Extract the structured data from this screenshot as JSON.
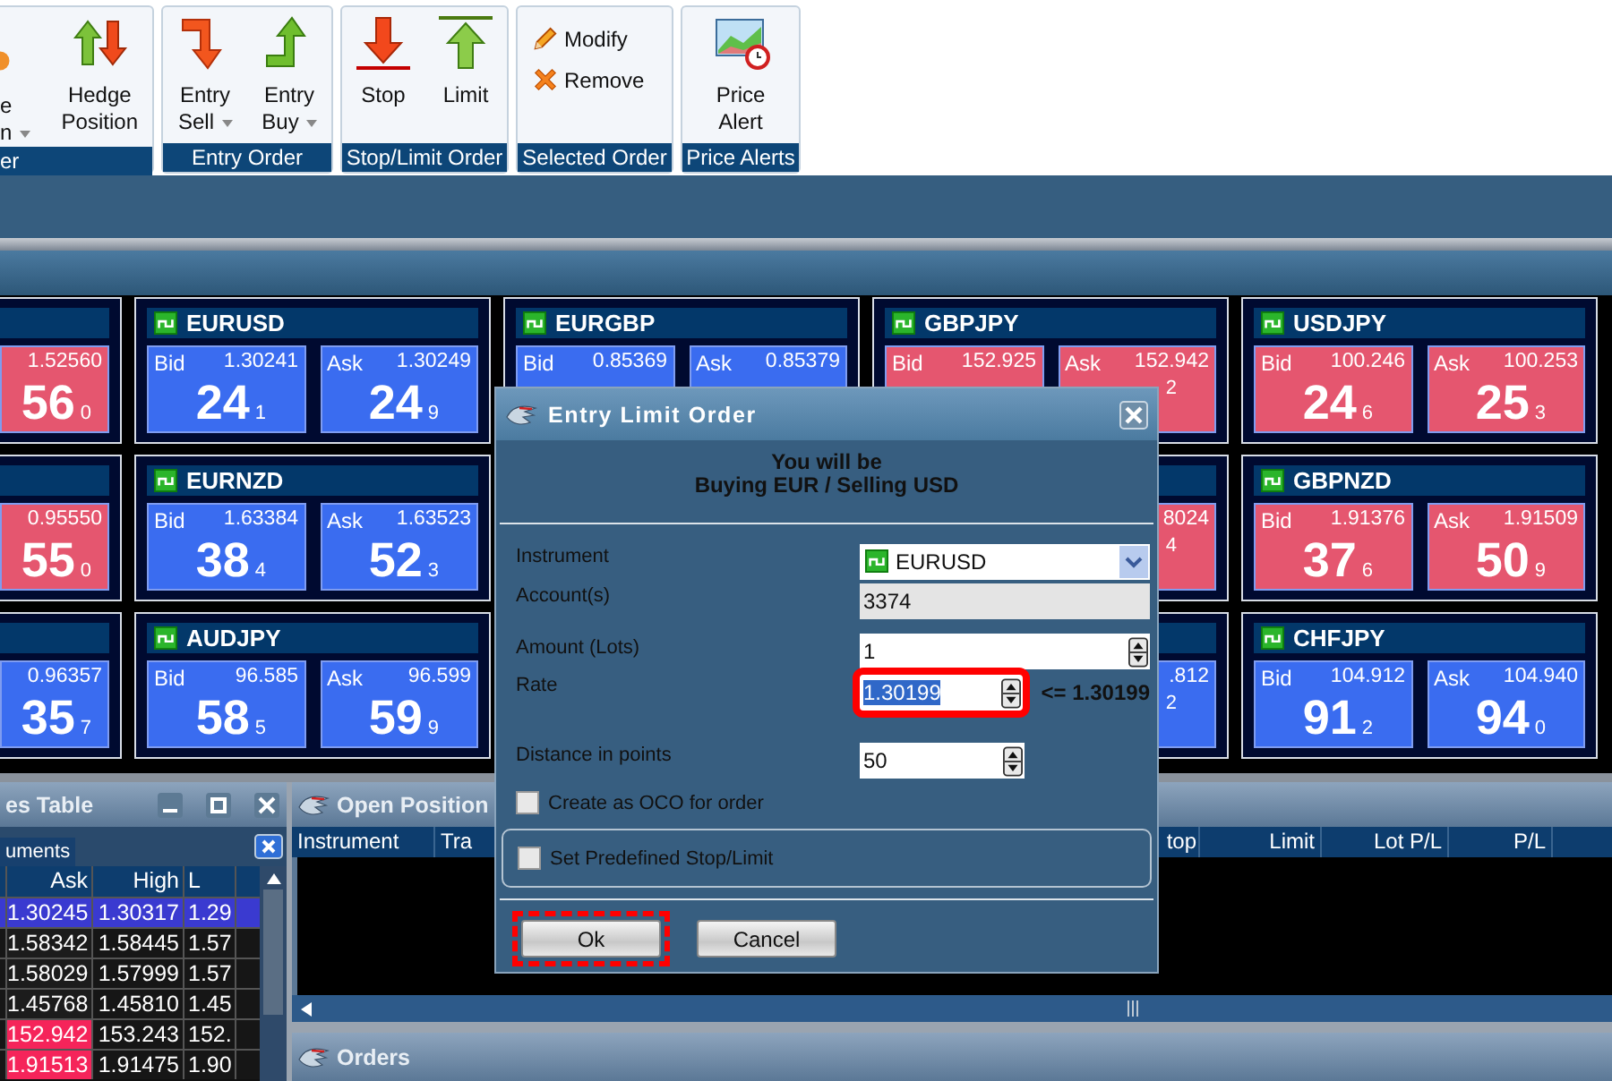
{
  "ribbon": {
    "groups": [
      {
        "label": "er",
        "buttons": [
          {
            "kind": "large",
            "lines": [
              "e",
              "n"
            ],
            "dropdown": true
          },
          {
            "kind": "large",
            "lines": [
              "Hedge",
              "Position"
            ],
            "dropdown": false
          }
        ]
      },
      {
        "label": "Entry Order",
        "buttons": [
          {
            "kind": "large",
            "lines": [
              "Entry",
              "Sell"
            ],
            "dropdown": true
          },
          {
            "kind": "large",
            "lines": [
              "Entry",
              "Buy"
            ],
            "dropdown": true
          }
        ]
      },
      {
        "label": "Stop/Limit Order",
        "buttons": [
          {
            "kind": "large",
            "lines": [
              "Stop"
            ],
            "dropdown": false
          },
          {
            "kind": "large",
            "lines": [
              "Limit"
            ],
            "dropdown": false
          }
        ]
      },
      {
        "label": "Selected Order",
        "buttons": [
          {
            "kind": "small",
            "lines": [
              "Modify"
            ],
            "dropdown": false
          },
          {
            "kind": "small",
            "lines": [
              "Remove"
            ],
            "dropdown": false
          }
        ]
      },
      {
        "label": "Price Alerts",
        "buttons": [
          {
            "kind": "large",
            "lines": [
              "Price",
              "Alert"
            ],
            "dropdown": false
          }
        ]
      }
    ]
  },
  "tiles": [
    {
      "kind": "edge",
      "ask": {
        "price": "1.52560",
        "big": "56",
        "small": "0",
        "color": "#e5566f"
      }
    },
    {
      "kind": "full",
      "name": "EURUSD",
      "bid": {
        "label": "Bid",
        "price": "1.30241",
        "big": "24",
        "small": "1",
        "color": "#3a6cf0"
      },
      "ask": {
        "label": "Ask",
        "price": "1.30249",
        "big": "24",
        "small": "9",
        "color": "#3a6cf0"
      }
    },
    {
      "kind": "full",
      "name": "EURGBP",
      "bid": {
        "label": "Bid",
        "price": "0.85369",
        "color": "#3a6cf0"
      },
      "ask": {
        "label": "Ask",
        "price": "0.85379",
        "color": "#3a6cf0"
      }
    },
    {
      "kind": "full",
      "name": "GBPJPY",
      "bid": {
        "label": "Bid",
        "price": "152.925",
        "color": "#e5566f"
      },
      "ask": {
        "label": "Ask",
        "price": "152.942",
        "small": "2",
        "color": "#e5566f"
      }
    },
    {
      "kind": "full",
      "name": "USDJPY",
      "bid": {
        "label": "Bid",
        "price": "100.246",
        "big": "24",
        "small": "6",
        "color": "#e5566f"
      },
      "ask": {
        "label": "Ask",
        "price": "100.253",
        "big": "25",
        "small": "3",
        "color": "#e5566f"
      }
    },
    {
      "kind": "edge",
      "ask": {
        "price": "0.95550",
        "big": "55",
        "small": "0",
        "color": "#e5566f"
      }
    },
    {
      "kind": "full",
      "name": "EURNZD",
      "bid": {
        "label": "Bid",
        "price": "1.63384",
        "big": "38",
        "small": "4",
        "color": "#3a6cf0"
      },
      "ask": {
        "label": "Ask",
        "price": "1.63523",
        "big": "52",
        "small": "3",
        "color": "#3a6cf0"
      }
    },
    {
      "kind": "hidden"
    },
    {
      "kind": "full",
      "ask": {
        "price": "8024",
        "small": "4",
        "color": "#e5566f"
      }
    },
    {
      "kind": "full",
      "name": "GBPNZD",
      "bid": {
        "label": "Bid",
        "price": "1.91376",
        "big": "37",
        "small": "6",
        "color": "#e5566f"
      },
      "ask": {
        "label": "Ask",
        "price": "1.91509",
        "big": "50",
        "small": "9",
        "color": "#e5566f"
      }
    },
    {
      "kind": "edge",
      "ask": {
        "price": "0.96357",
        "big": "35",
        "small": "7",
        "color": "#3a6cf0"
      }
    },
    {
      "kind": "full",
      "name": "AUDJPY",
      "bid": {
        "label": "Bid",
        "price": "96.585",
        "big": "58",
        "small": "5",
        "color": "#3a6cf0"
      },
      "ask": {
        "label": "Ask",
        "price": "96.599",
        "big": "59",
        "small": "9",
        "color": "#3a6cf0"
      }
    },
    {
      "kind": "hidden"
    },
    {
      "kind": "full",
      "ask": {
        "price": ".812",
        "small": "2",
        "color": "#3a6cf0"
      }
    },
    {
      "kind": "full",
      "name": "CHFJPY",
      "bid": {
        "label": "Bid",
        "price": "104.912",
        "big": "91",
        "small": "2",
        "color": "#3a6cf0"
      },
      "ask": {
        "label": "Ask",
        "price": "104.940",
        "big": "94",
        "small": "0",
        "color": "#3a6cf0"
      }
    }
  ],
  "rates_table": {
    "title": "es Table",
    "tab": "uments",
    "columns": [
      "Ask",
      "High",
      "L"
    ],
    "rows": [
      {
        "selected": true,
        "ask": "1.30245",
        "color": "#3a3ad0",
        "high": "1.30317",
        "low": "1.29"
      },
      {
        "selected": false,
        "ask": "1.58342",
        "color": "#1c1c1c",
        "high": "1.58445",
        "low": "1.57"
      },
      {
        "selected": false,
        "ask": "1.58029",
        "color": "#1c1c1c",
        "high": "1.57999",
        "low": "1.57"
      },
      {
        "selected": false,
        "ask": "1.45768",
        "color": "#1c1c1c",
        "high": "1.45810",
        "low": "1.45"
      },
      {
        "selected": false,
        "ask": "152.942",
        "color": "#f5245a",
        "high": "153.243",
        "low": "152."
      },
      {
        "selected": false,
        "ask": "1.91513",
        "color": "#f5245a",
        "high": "1.91475",
        "low": "1.90"
      }
    ]
  },
  "positions": {
    "title": "Open Position",
    "columns": [
      "Instrument",
      "Tra",
      "top",
      "Limit",
      "Lot P/L",
      "P/L"
    ]
  },
  "orders": {
    "title": "Orders"
  },
  "dialog": {
    "title": "Entry Limit Order",
    "message": [
      "You will be",
      "Buying EUR / Selling USD"
    ],
    "fields": [
      {
        "kind": "dropdown",
        "label": "Instrument",
        "value": "EURUSD"
      },
      {
        "kind": "readonly",
        "label": "Account(s)",
        "value": "3374"
      },
      {
        "kind": "spinner",
        "label": "Amount (Lots)",
        "value": "1",
        "selected_text": false,
        "highlighted": false
      },
      {
        "kind": "short-spinner",
        "label": "Rate",
        "value": "1.30199",
        "selected_text": true,
        "highlighted": true,
        "hint": "<= 1.30199"
      },
      {
        "kind": "short-spinner",
        "label": "Distance in points",
        "value": "50",
        "selected_text": false,
        "highlighted": false
      }
    ],
    "checkboxes": [
      {
        "label": "Create as OCO for order",
        "checked": false,
        "grouped": false
      },
      {
        "label": "Set Predefined Stop/Limit",
        "checked": false,
        "grouped": true
      }
    ],
    "buttons": [
      {
        "label": "Ok",
        "highlighted": true
      },
      {
        "label": "Cancel",
        "highlighted": false
      }
    ]
  }
}
